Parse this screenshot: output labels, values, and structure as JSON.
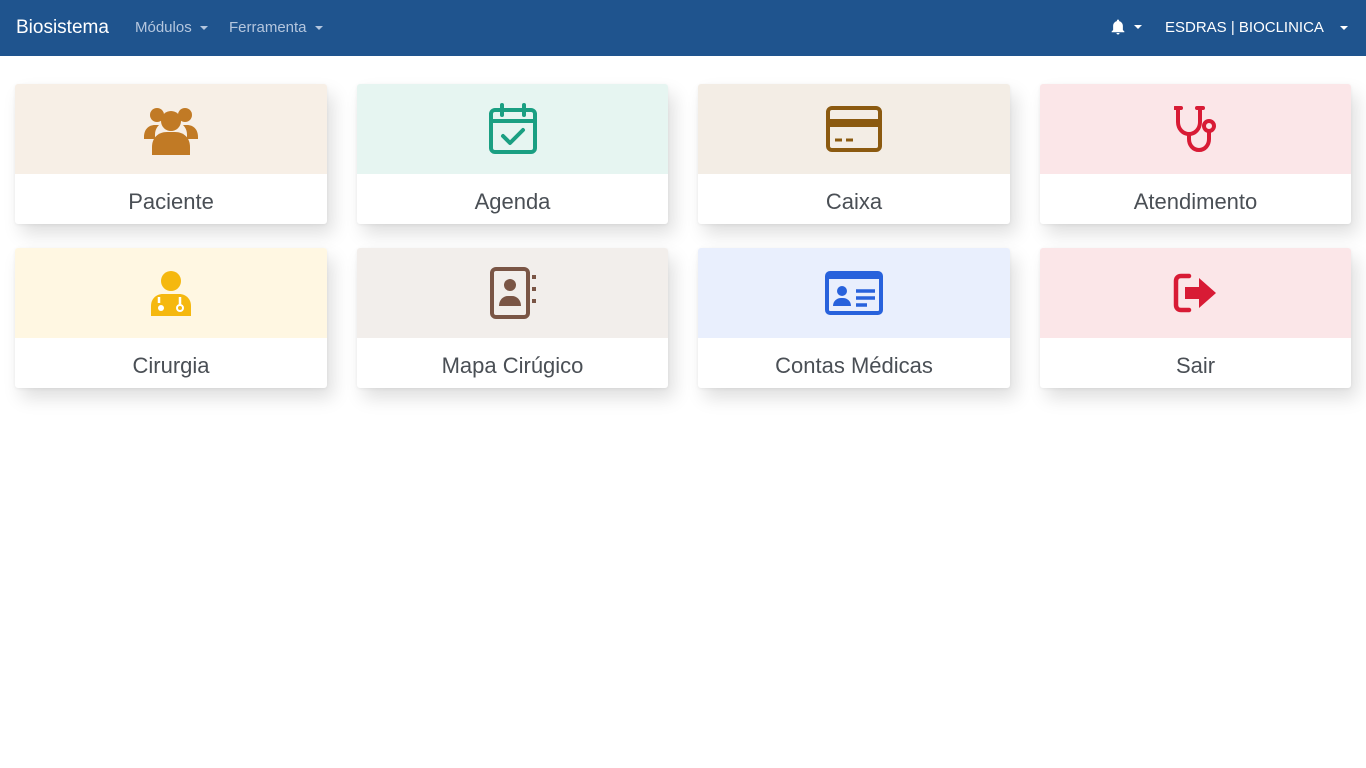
{
  "navbar": {
    "brand": "Biosistema",
    "menu_modulos": "Módulos",
    "menu_ferramenta": "Ferramenta",
    "notifications_icon": "bell-icon",
    "user": "ESDRAS | BIOCLINICA"
  },
  "cards": [
    {
      "label": "Paciente",
      "icon": "users-icon",
      "bg": "#f7efe6",
      "color": "#c17a25"
    },
    {
      "label": "Agenda",
      "icon": "calendar-check-icon",
      "bg": "#e6f5f1",
      "color": "#1a9f82"
    },
    {
      "label": "Caixa",
      "icon": "credit-card-icon",
      "bg": "#f3ede5",
      "color": "#8b5a10"
    },
    {
      "label": "Atendimento",
      "icon": "stethoscope-icon",
      "bg": "#fbe6e8",
      "color": "#d81b35"
    },
    {
      "label": "Cirurgia",
      "icon": "doctor-icon",
      "bg": "#fff7e2",
      "color": "#f5b80f"
    },
    {
      "label": "Mapa Cirúgico",
      "icon": "address-book-icon",
      "bg": "#f2eeeb",
      "color": "#7a5545"
    },
    {
      "label": "Contas Médicas",
      "icon": "id-card-icon",
      "bg": "#e9effd",
      "color": "#2862dc"
    },
    {
      "label": "Sair",
      "icon": "sign-out-icon",
      "bg": "#fbe6e8",
      "color": "#d81b35"
    }
  ]
}
